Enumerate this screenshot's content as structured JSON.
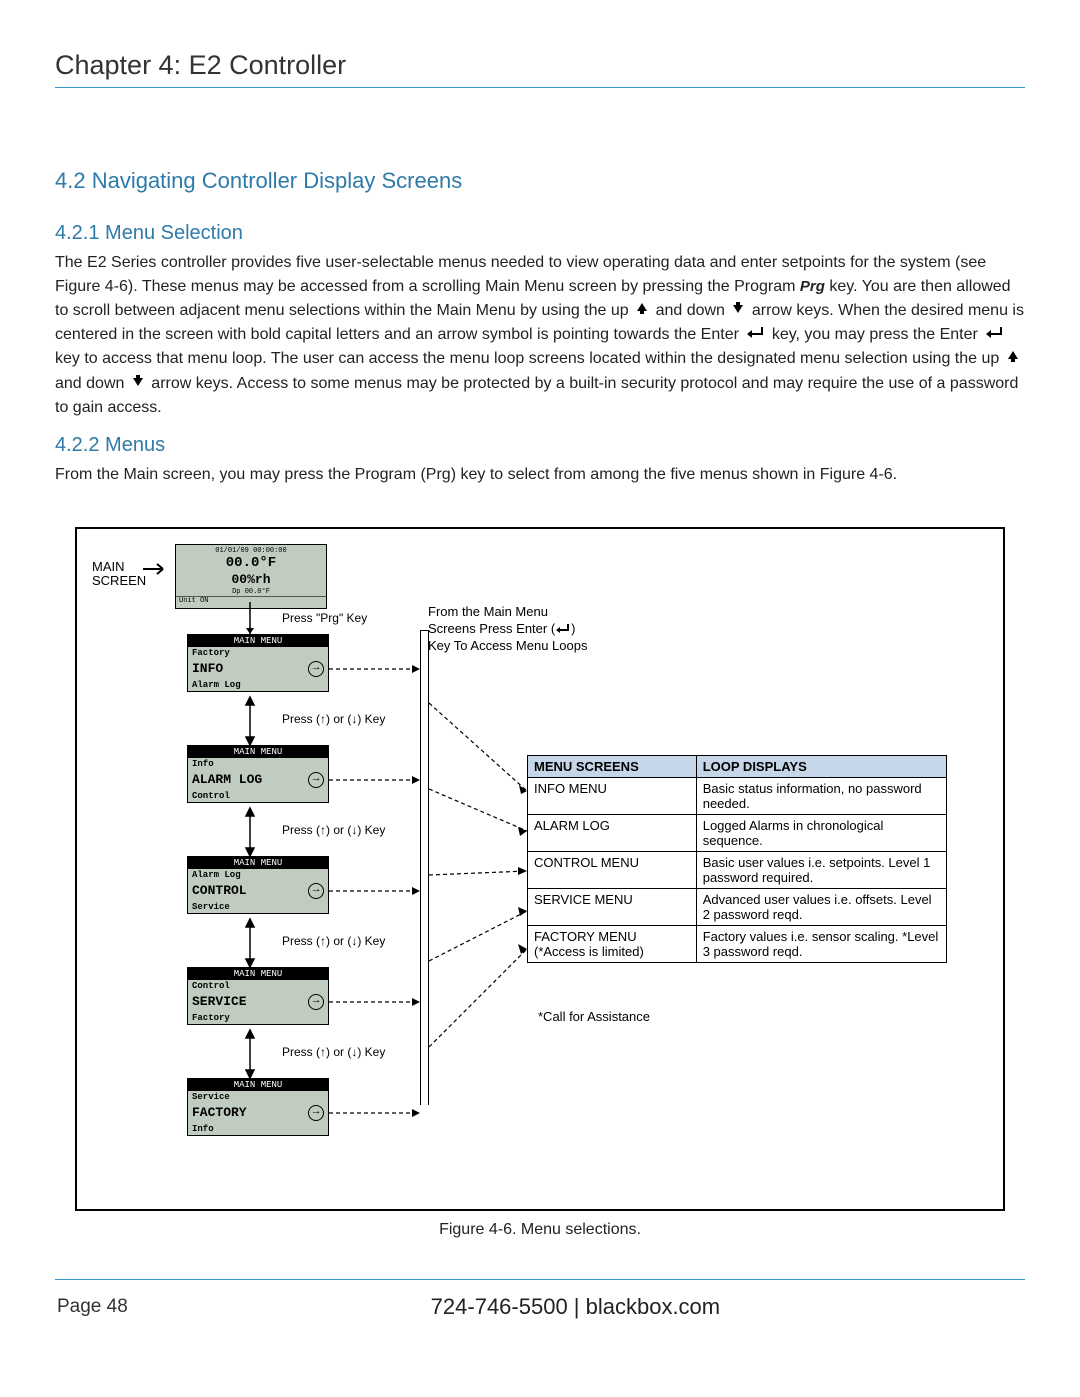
{
  "chapter_title": "Chapter 4: E2 Controller",
  "section_4_2": "4.2 Navigating Controller Display Screens",
  "section_4_2_1_title": "4.2.1 Menu Selection",
  "para_4_2_1_a": "The E2 Series controller provides five user-selectable menus needed to view operating data and enter setpoints for the system (see Figure 4-6). These menus may be accessed from a scrolling Main Menu screen by pressing the Program ",
  "prg_label": "Prg",
  "para_4_2_1_b": " key. You are then allowed to scroll between adjacent menu selections within the Main Menu by using the up ",
  "para_4_2_1_c": " and down ",
  "para_4_2_1_d": " arrow keys. When the desired menu is centered in the screen with bold capital letters and an arrow symbol is pointing towards the Enter ",
  "para_4_2_1_e": " key, you may press the Enter ",
  "para_4_2_1_f": " key to access that menu loop. The user can access the menu loop screens located within the designated menu selection using the up ",
  "para_4_2_1_g": " and down ",
  "para_4_2_1_h": " arrow keys. Access to some menus may be protected by a built-in security protocol and may require the use of a password to gain access.",
  "section_4_2_2_title": "4.2.2 Menus",
  "para_4_2_2": "From the Main screen, you may press the Program (Prg) key to select from among the five menus shown in Figure 4-6.",
  "main_screen_label_top": "MAIN",
  "main_screen_label_bot": "SCREEN",
  "main_screen": {
    "timestamp": "01/01/09 00:00:00",
    "temp": "00.0°F",
    "rh": "00%rh",
    "dp": "Dp 00.0°F",
    "unit": "Unit ON"
  },
  "press_prg": "Press \"Prg\" Key",
  "from_main_menu": "From the Main Menu\nScreens Press Enter (↵)\nKey To Access Menu Loops",
  "updown_key": "Press (↑) or (↓) Key",
  "menu_header": "MAIN MENU",
  "menus": [
    {
      "prev": "Factory",
      "sel": "INFO",
      "next": "Alarm Log"
    },
    {
      "prev": "Info",
      "sel": "ALARM LOG",
      "next": "Control"
    },
    {
      "prev": "Alarm Log",
      "sel": "CONTROL",
      "next": "Service"
    },
    {
      "prev": "Control",
      "sel": "SERVICE",
      "next": "Factory"
    },
    {
      "prev": "Service",
      "sel": "FACTORY",
      "next": "Info"
    }
  ],
  "table_head_a": "MENU SCREENS",
  "table_head_b": "LOOP DISPLAYS",
  "table_rows": [
    {
      "a": "INFO MENU",
      "b": "Basic status information, no password needed."
    },
    {
      "a": "ALARM LOG",
      "b": "Logged Alarms in chronological sequence."
    },
    {
      "a": "CONTROL MENU",
      "b": "Basic user values i.e. setpoints. Level 1 password required."
    },
    {
      "a": "SERVICE MENU",
      "b": "Advanced user values i.e. offsets. Level 2 password reqd."
    },
    {
      "a": "FACTORY MENU (*Access is limited)",
      "b": "Factory values i.e. sensor scaling. *Level 3 password reqd."
    }
  ],
  "call_assist": "*Call for Assistance",
  "figure_caption": "Figure 4-6. Menu selections.",
  "footer_page": "Page 48",
  "footer_contact": "724-746-5500   |   blackbox.com"
}
